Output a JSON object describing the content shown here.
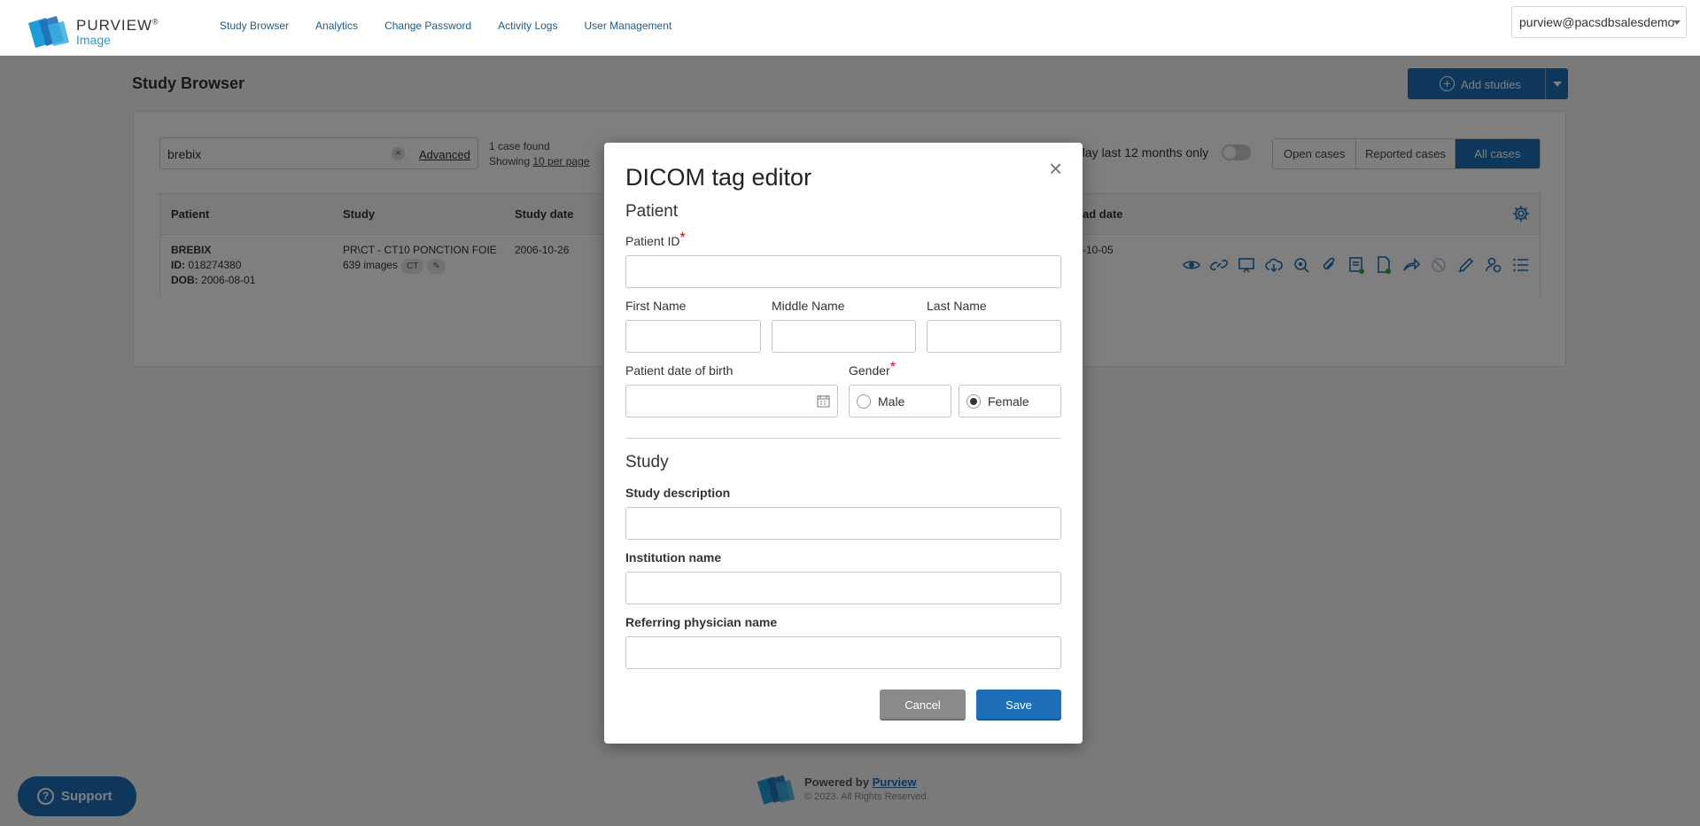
{
  "brand": {
    "name": "PURVIEW",
    "reg_mark": "®",
    "sub": "Image"
  },
  "nav": {
    "items": [
      "Study Browser",
      "Analytics",
      "Change Password",
      "Activity Logs",
      "User Management"
    ]
  },
  "user_menu": {
    "value": "purview@pacsdbsalesdemo"
  },
  "page": {
    "title": "Study Browser",
    "add_studies_label": "Add studies"
  },
  "search": {
    "value": "brebix",
    "clear": "×",
    "advanced_label": "Advanced"
  },
  "results": {
    "count_text": "1 case found",
    "showing_prefix": "Showing",
    "per_page": "10 per page"
  },
  "filter": {
    "display_toggle_label": "play last 12 months only",
    "display_toggle_on": false,
    "tabs": [
      "Open cases",
      "Reported cases",
      "All cases"
    ],
    "active_tab": "All cases"
  },
  "table": {
    "columns": [
      "Patient",
      "Study",
      "Study date",
      "ad date"
    ],
    "rows": [
      {
        "patient_name": "BREBIX",
        "patient_id_label": "ID:",
        "patient_id": "018274380",
        "dob_label": "DOB:",
        "dob": "2006-08-01",
        "study": "PR\\CT - CT10 PONCTION FOIE",
        "images": "639 images",
        "modality": "CT",
        "study_date": "2006-10-26",
        "upload_date": "-10-05"
      }
    ],
    "action_icons": [
      "view-icon",
      "link-icon",
      "present-icon",
      "download-icon",
      "search-icon",
      "attach-icon",
      "report-icon",
      "document-icon",
      "share-icon",
      "block-icon",
      "edit-icon",
      "assign-icon",
      "list-icon"
    ]
  },
  "support": {
    "label": "Support"
  },
  "footer": {
    "powered_by": "Powered by",
    "brand_link": "Purview",
    "copyright": "© 2023. All Rights Reserved."
  },
  "modal": {
    "title": "DICOM tag editor",
    "close": "×",
    "patient_section": "Patient",
    "patient_id_label": "Patient ID",
    "required_mark": "*",
    "first_name_label": "First Name",
    "middle_name_label": "Middle Name",
    "last_name_label": "Last Name",
    "dob_label": "Patient date of birth",
    "gender_label": "Gender",
    "gender_options": [
      "Male",
      "Female"
    ],
    "gender_selected": "Female",
    "study_section": "Study",
    "study_description_label": "Study description",
    "institution_label": "Institution name",
    "referring_label": "Referring physician name",
    "cancel_label": "Cancel",
    "save_label": "Save"
  },
  "colors": {
    "accent": "#1e6fb8",
    "brand_light": "#1f9bd7",
    "required": "#d0021b"
  }
}
